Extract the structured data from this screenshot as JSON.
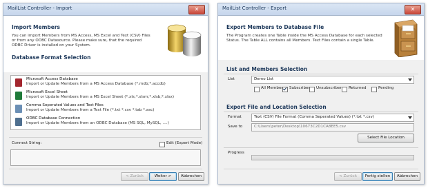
{
  "import_window": {
    "title": "MailList Controller - Import",
    "heading": "Import Members",
    "description": [
      "You can import Members from MS Access, MS Excel and Text (CSV) Files",
      "or from any ODBC Datasource. Please make sure, that the required",
      "ODBC Driver is installed on your System."
    ],
    "section_title": "Database Format Selection",
    "options": [
      {
        "title": "Microsoft Access Database",
        "desc": "Import or Update Members from a MS Access Database (*.mdb;*.accdb)",
        "icon": "access-icon",
        "color": "#a3262e"
      },
      {
        "title": "Microsoft Excel Sheet",
        "desc": "Import or Update Members from a MS Excel Sheet (*.xls;*.xlsm;*.xlsb;*.xlsx)",
        "icon": "excel-icon",
        "color": "#1f7a3a"
      },
      {
        "title": "Comma Seperated Values and Text Files",
        "desc": "Import or Update Members from a Text File (*.txt *.csv *.tab *.asc)",
        "icon": "text-file-icon",
        "color": "#6b8fb5"
      },
      {
        "title": "ODBC Database Connection",
        "desc": "Import or Update Members from an ODBC Database (MS SQL, MySQL, ....)",
        "icon": "odbc-icon",
        "color": "#4f6f8f"
      }
    ],
    "connect_label": "Connect String:",
    "edit_checkbox_label": "Edit (Expert Mode)",
    "edit_checked": false,
    "back_label": "< Zurück",
    "next_label": "Weiter >",
    "cancel_label": "Abbrechen"
  },
  "export_window": {
    "title": "MailList Controller - Export",
    "heading": "Export Members to Database File",
    "description": [
      "The Program creates one Table inside the MS Access Database for each selected",
      "Status. The Table ALL contains all Members. Text Files contain a single Table."
    ],
    "list_section": "List and Members Selection",
    "list_label": "List",
    "list_value": "Demo List",
    "statuses": [
      {
        "label": "All Members",
        "checked": false
      },
      {
        "label": "Subscriber",
        "checked": true
      },
      {
        "label": "Unsubscriber",
        "checked": false
      },
      {
        "label": "Returned",
        "checked": false
      },
      {
        "label": "Pending",
        "checked": false
      }
    ],
    "file_section": "Export File and Location Selection",
    "format_label": "Format",
    "format_value": "Text (CSV) File Format (Comma Seperated Values) (*.txt *.csv)",
    "save_label": "Save to",
    "save_value": "C:\\Users\\peter\\Desktop\\10673C2D1CA8EE5.csv",
    "select_location_label": "Select File Location",
    "progress_label": "Progress",
    "progress_value": 0,
    "back_label": "< Zurück",
    "finish_label": "Fertig stellen",
    "cancel_label": "Abbrechen"
  }
}
